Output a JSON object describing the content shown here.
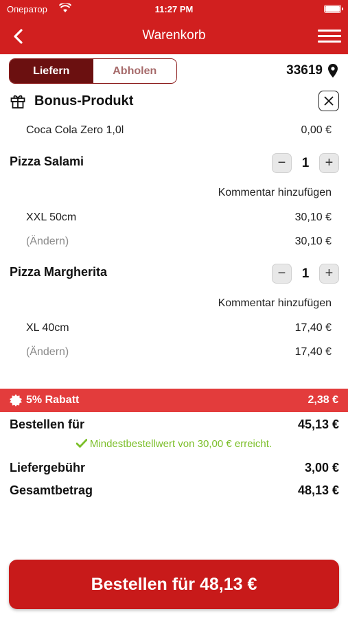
{
  "status": {
    "carrier": "Оператор",
    "time": "11:27 PM"
  },
  "nav": {
    "title": "Warenkorb"
  },
  "mode": {
    "delivery": "Liefern",
    "pickup": "Abholen",
    "selected": "Liefern"
  },
  "zip": "33619",
  "bonus": {
    "title": "Bonus-Produkt",
    "item": "Coca Cola Zero 1,0l",
    "price": "0,00 €"
  },
  "items": [
    {
      "name": "Pizza Salami",
      "qty": "1",
      "comment": "Kommentar hinzufügen",
      "size": "XXL 50cm",
      "size_price": "30,10 €",
      "change": "(Ändern)",
      "total": "30,10 €"
    },
    {
      "name": "Pizza Margherita",
      "qty": "1",
      "comment": "Kommentar hinzufügen",
      "size": "XL 40cm",
      "size_price": "17,40 €",
      "change": "(Ändern)",
      "total": "17,40 €"
    }
  ],
  "discount": {
    "label": "5% Rabatt",
    "value": "2,38 €"
  },
  "summary": {
    "order_label": "Bestellen für",
    "order_value": "45,13 €",
    "min_ok": "Mindestbestellwert von 30,00 € erreicht.",
    "delivery_label": "Liefergebühr",
    "delivery_value": "3,00 €",
    "total_label": "Gesamtbetrag",
    "total_value": "48,13 €"
  },
  "order_button": "Bestellen für 48,13 €",
  "colors": {
    "brand": "#d11f1f",
    "dark": "#6b1010",
    "discount": "#e33c3c",
    "success": "#7cbf2a"
  }
}
